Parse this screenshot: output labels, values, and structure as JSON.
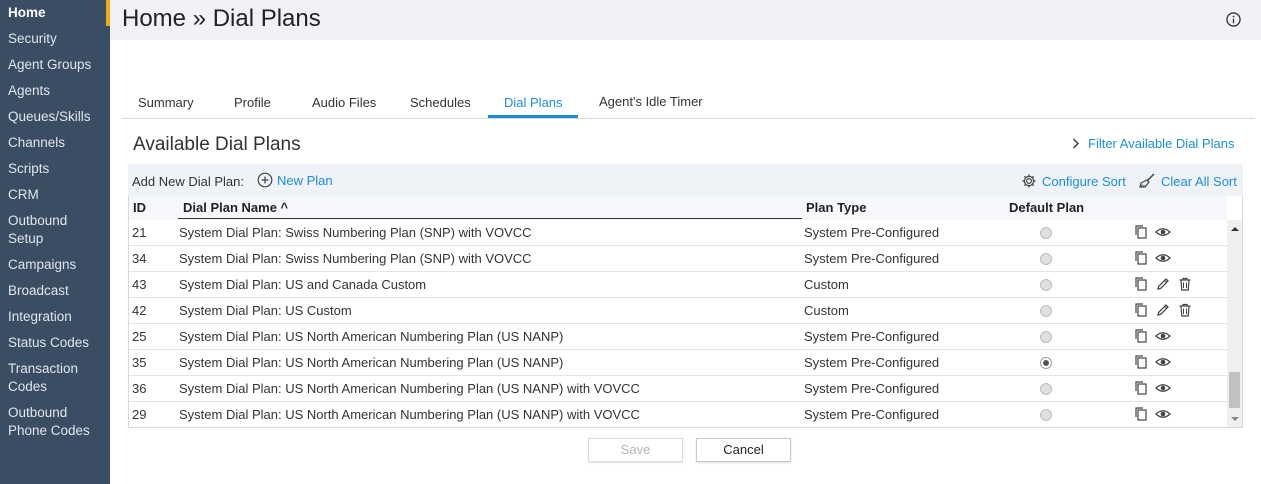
{
  "sidebar": {
    "items": [
      {
        "label": "Home",
        "active": true
      },
      {
        "label": "Security"
      },
      {
        "label": "Agent Groups"
      },
      {
        "label": "Agents"
      },
      {
        "label": "Queues/Skills"
      },
      {
        "label": "Channels"
      },
      {
        "label": "Scripts"
      },
      {
        "label": "CRM"
      },
      {
        "label": "Outbound Setup"
      },
      {
        "label": "Campaigns"
      },
      {
        "label": "Broadcast"
      },
      {
        "label": "Integration"
      },
      {
        "label": "Status Codes"
      },
      {
        "label": "Transaction Codes"
      },
      {
        "label": "Outbound Phone Codes"
      }
    ]
  },
  "header": {
    "title": "Home » Dial Plans",
    "info_icon": "info-icon"
  },
  "tabs": [
    {
      "label": "Summary"
    },
    {
      "label": "Profile"
    },
    {
      "label": "Audio Files"
    },
    {
      "label": "Schedules"
    },
    {
      "label": "Dial Plans",
      "active": true
    },
    {
      "label": "Agent's Idle Timer"
    }
  ],
  "section": {
    "title": "Available Dial Plans",
    "filter_link": "Filter Available Dial Plans"
  },
  "toolbar": {
    "add_label": "Add New Dial Plan:",
    "new_plan": "New Plan",
    "configure_sort": "Configure Sort",
    "clear_sort": "Clear All Sort"
  },
  "table": {
    "columns": {
      "id": "ID",
      "name": "Dial Plan Name ^",
      "type": "Plan Type",
      "default": "Default Plan"
    },
    "rows": [
      {
        "id": "21",
        "name": "System Dial Plan: Swiss Numbering Plan (SNP) with VOVCC",
        "type": "System Pre-Configured",
        "default": false,
        "editable": false
      },
      {
        "id": "34",
        "name": "System Dial Plan: Swiss Numbering Plan (SNP) with VOVCC",
        "type": "System Pre-Configured",
        "default": false,
        "editable": false
      },
      {
        "id": "43",
        "name": "System Dial Plan: US and Canada Custom",
        "type": "Custom",
        "default": false,
        "editable": true
      },
      {
        "id": "42",
        "name": "System Dial Plan: US Custom",
        "type": "Custom",
        "default": false,
        "editable": true
      },
      {
        "id": "25",
        "name": "System Dial Plan: US North American Numbering Plan (US NANP)",
        "type": "System Pre-Configured",
        "default": false,
        "editable": false
      },
      {
        "id": "35",
        "name": "System Dial Plan: US North American Numbering Plan (US NANP)",
        "type": "System Pre-Configured",
        "default": true,
        "editable": false
      },
      {
        "id": "36",
        "name": "System Dial Plan: US North American Numbering Plan (US NANP) with VOVCC",
        "type": "System Pre-Configured",
        "default": false,
        "editable": false
      },
      {
        "id": "29",
        "name": "System Dial Plan: US North American Numbering Plan (US NANP) with VOVCC",
        "type": "System Pre-Configured",
        "default": false,
        "editable": false
      }
    ]
  },
  "footer": {
    "save": "Save",
    "cancel": "Cancel",
    "save_enabled": false
  },
  "colors": {
    "sidebar_bg": "#3b4d63",
    "accent": "#1a8fd6",
    "active_marker": "#f2a619"
  }
}
